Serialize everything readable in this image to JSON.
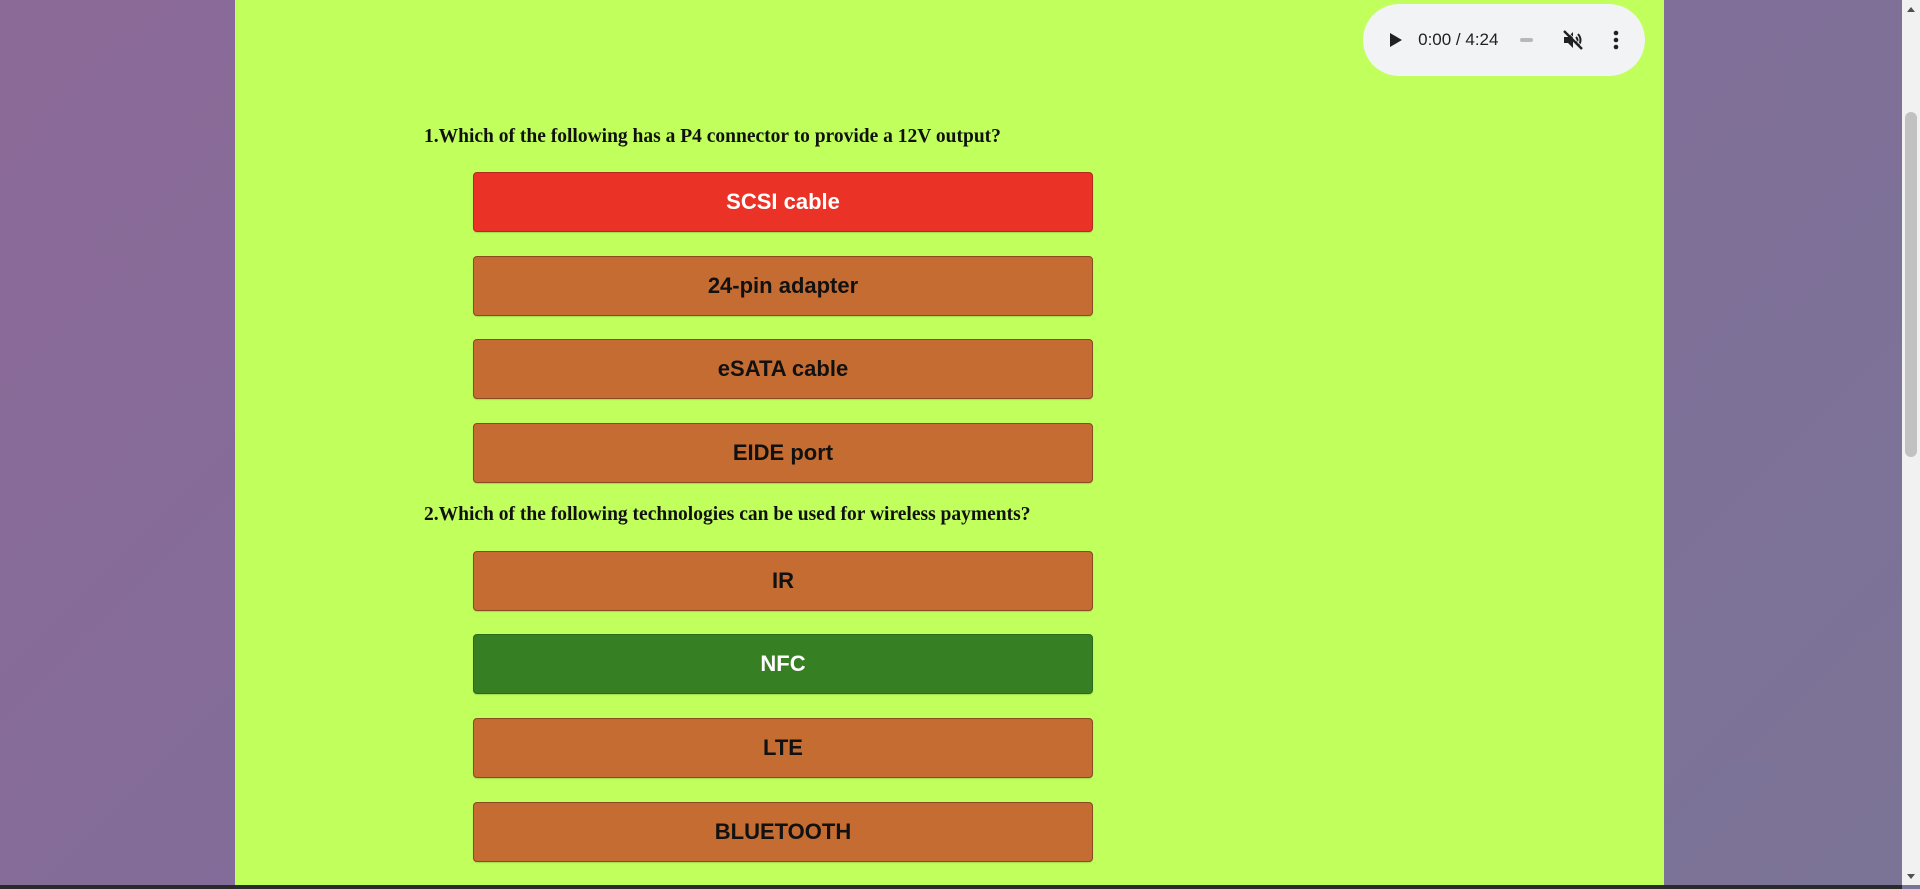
{
  "audio": {
    "time": "0:00 / 4:24"
  },
  "questions": [
    {
      "text": "1.Which of the following has a P4 connector to provide a 12V output?",
      "options": [
        "SCSI cable",
        "24-pin adapter",
        "eSATA cable",
        "EIDE port"
      ],
      "selected_wrong": "SCSI cable"
    },
    {
      "text": "2.Which of the following technologies can be used for wireless payments?",
      "options": [
        "IR",
        "NFC",
        "LTE",
        "BLUETOOTH"
      ],
      "selected_correct": "NFC"
    }
  ],
  "colors": {
    "card_background": "#c1ff5c",
    "option_default": "#c46c32",
    "option_wrong": "#ea3326",
    "option_correct": "#367f23"
  },
  "icons": {
    "play": "play-icon",
    "mute": "volume-muted-icon",
    "menu": "more-vert-icon"
  }
}
